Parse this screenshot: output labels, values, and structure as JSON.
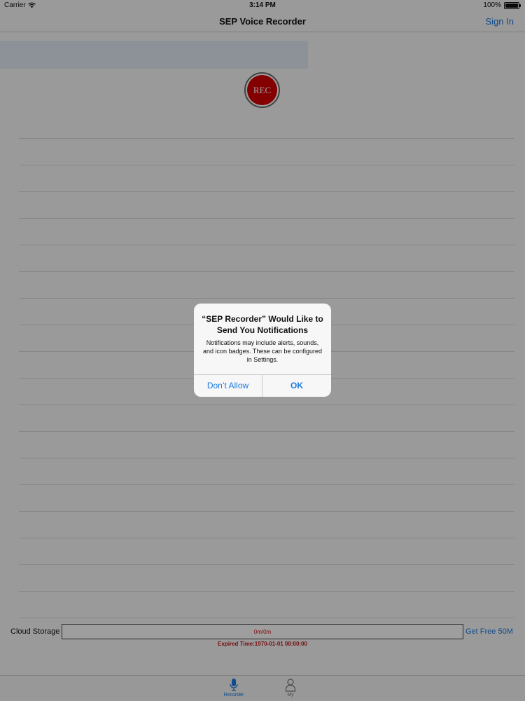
{
  "status_bar": {
    "carrier": "Carrier",
    "time": "3:14 PM",
    "battery": "100%",
    "icons": [
      "wifi-icon",
      "battery-icon"
    ]
  },
  "nav": {
    "title": "SEP Voice Recorder",
    "right_button": "Sign In"
  },
  "recorder": {
    "rec_label": "REC"
  },
  "cloud": {
    "label": "Cloud Storage",
    "usage": "0m/0m",
    "usage_fraction": 0,
    "get_free": "Get Free 50M",
    "expired": "Expired Time:1970-01-01 08:00:00"
  },
  "tab_bar": {
    "tabs": [
      {
        "label": "Recorder",
        "icon": "microphone-icon",
        "selected": true
      },
      {
        "label": "My",
        "icon": "person-icon",
        "selected": false
      }
    ]
  },
  "alert": {
    "title": "“SEP Recorder” Would Like to Send You Notifications",
    "message": "Notifications may include alerts, sounds, and icon badges. These can be configured in Settings.",
    "buttons": [
      "Don’t Allow",
      "OK"
    ]
  },
  "colors": {
    "accent": "#1a7ae0",
    "record_red": "#d50000",
    "status_red": "#c01818",
    "dim_overlay": "rgba(0,0,0,0.38)"
  }
}
